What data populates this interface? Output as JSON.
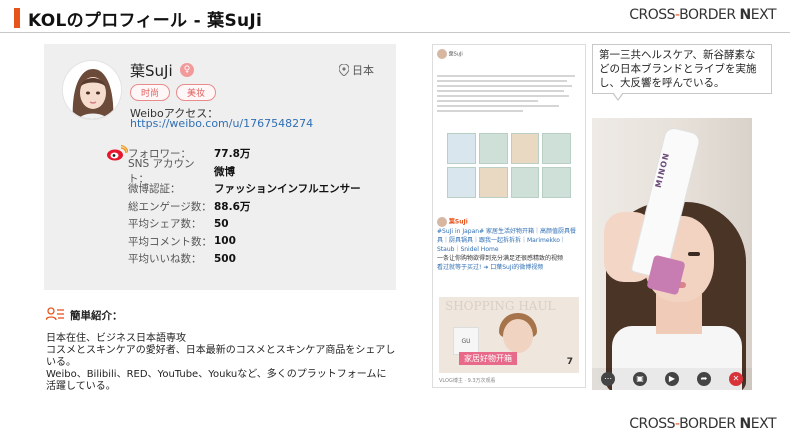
{
  "header": {
    "title": "KOLのプロフィール - 葉SuJi",
    "logo": {
      "text_before": "CROSS",
      "dash": "-",
      "text_mid": "BORDER ",
      "text_n": "N",
      "text_after": "EXT"
    }
  },
  "profile": {
    "name": "葉SuJi",
    "location": "日本",
    "tags": [
      "时尚",
      "美妆"
    ],
    "weibo_label": "Weiboアクセス：",
    "weibo_url": "https://weibo.com/u/1767548274",
    "stats": [
      {
        "label": "フォロワー：",
        "value": "77.8万"
      },
      {
        "label": "SNS アカウント：",
        "value": "微博"
      },
      {
        "label": "微博認証：",
        "value": "ファッションインフルエンサー"
      },
      {
        "label": "総エンゲージ数：",
        "value": "88.6万"
      },
      {
        "label": "平均シェア数：",
        "value": "50"
      },
      {
        "label": "平均コメント数：",
        "value": "100"
      },
      {
        "label": "平均いいね数：",
        "value": "500"
      }
    ]
  },
  "intro": {
    "title": "簡単紹介：",
    "lines": [
      "日本在住、ビジネス日本語専攻",
      "コスメとスキンケアの愛好者、日本最新のコスメとスキンケア商品をシェアしいる。",
      "Weibo、Bilibili、RED、YouTube、Youkuなど、多くのプラットフォームに活躍している。"
    ]
  },
  "post": {
    "user": "葉SuJi",
    "hashtag": "#SuJi in Japan# 家居生活好物开箱｜高颜值厨具餐具｜厨具锅具｜跟我一起拆拆拆｜Marimekko｜Staub｜Snidel Home",
    "body": "一条让你购物欲得到充分满足还很感精致的视频",
    "link": "看过就等于买过! ➔ 口葉SuJi的微博视频",
    "image_title": "SHOPPING HAUL",
    "image_banner": "家居好物开箱",
    "image_num": "7",
    "footer": "VLOG博主 · 9.3万次观看"
  },
  "callout": {
    "text": "第一三共ヘルスケア、新谷酵素などの日本ブランドとライブを実施し、大反響を呼んでいる。"
  },
  "video": {
    "product_text": "MINON",
    "icons": [
      "more-icon",
      "save-icon",
      "play-icon",
      "share-icon",
      "close-icon"
    ]
  },
  "colors": {
    "accent": "#e8531c",
    "link": "#2f6fb5",
    "card_bg": "#efefef",
    "tag_border": "#e78b8b"
  }
}
